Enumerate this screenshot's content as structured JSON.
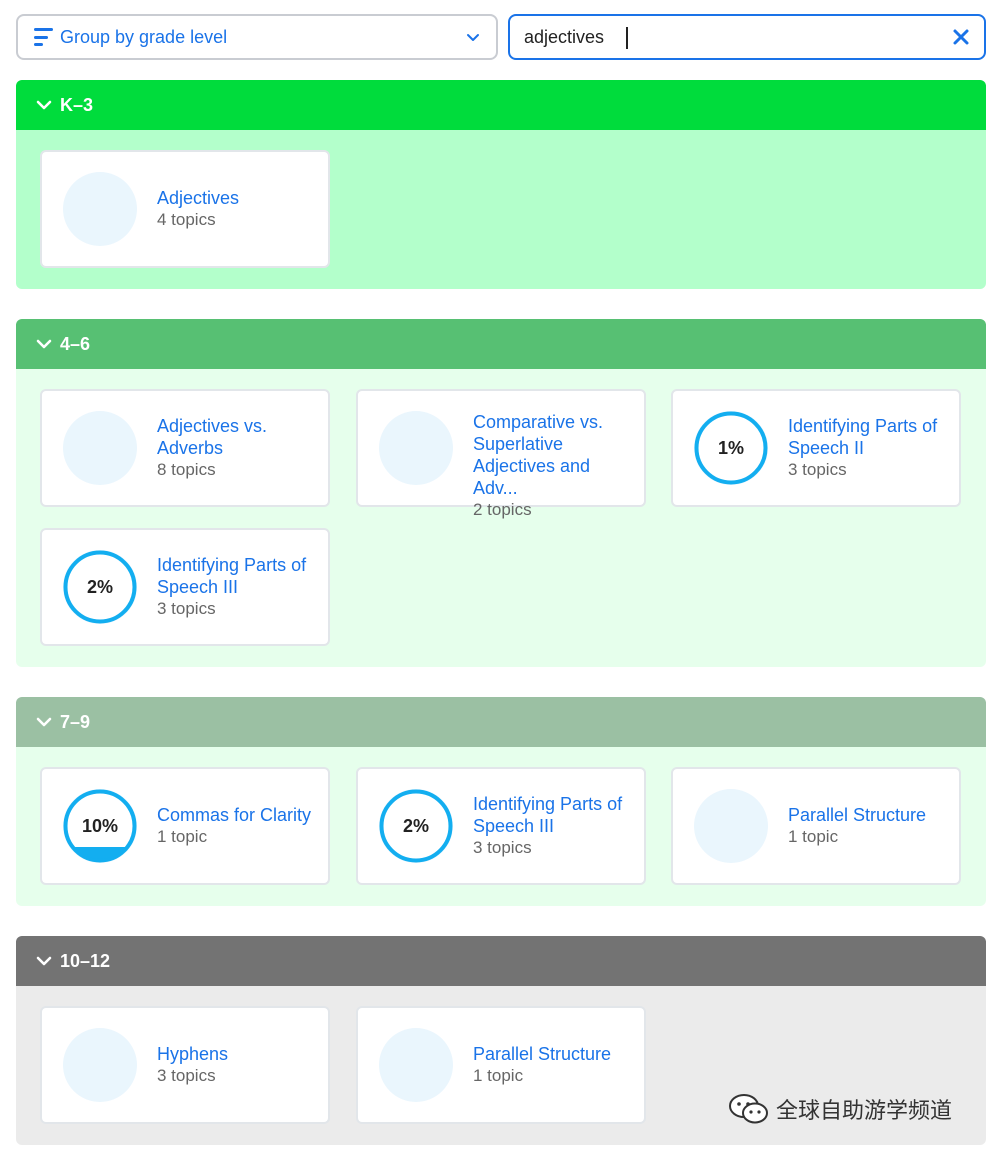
{
  "controls": {
    "group_label": "Group by grade level",
    "search_value": "adjectives"
  },
  "colors": {
    "accent": "#1a73e8",
    "ring": "#13aef0",
    "k3_header": "#00dc3c",
    "k3_body": "#b3ffcb",
    "g46_header": "#57c073",
    "g46_body": "#e6ffec",
    "g79_header": "#9bc0a3",
    "g79_body": "#e6ffec",
    "g1012_header": "#737373",
    "g1012_body": "#ebebeb"
  },
  "sections": [
    {
      "title": "K–3",
      "cards": [
        {
          "name": "Adjectives",
          "count": "4 topics",
          "progress": null
        }
      ]
    },
    {
      "title": "4–6",
      "cards": [
        {
          "name": "Adjectives vs. Adverbs",
          "count": "8 topics",
          "progress": null
        },
        {
          "name": "Comparative vs. Superlative Adjectives and Adv...",
          "count": "2 topics",
          "progress": null
        },
        {
          "name": "Identifying Parts of Speech II",
          "count": "3 topics",
          "progress": "1%"
        },
        {
          "name": "Identifying Parts of Speech III",
          "count": "3 topics",
          "progress": "2%"
        }
      ]
    },
    {
      "title": "7–9",
      "cards": [
        {
          "name": "Commas for Clarity",
          "count": "1 topic",
          "progress": "10%"
        },
        {
          "name": "Identifying Parts of Speech III",
          "count": "3 topics",
          "progress": "2%"
        },
        {
          "name": "Parallel Structure",
          "count": "1 topic",
          "progress": null
        }
      ]
    },
    {
      "title": "10–12",
      "cards": [
        {
          "name": "Hyphens",
          "count": "3 topics",
          "progress": null
        },
        {
          "name": "Parallel Structure",
          "count": "1 topic",
          "progress": null
        }
      ]
    }
  ],
  "watermark": "全球自助游学频道"
}
